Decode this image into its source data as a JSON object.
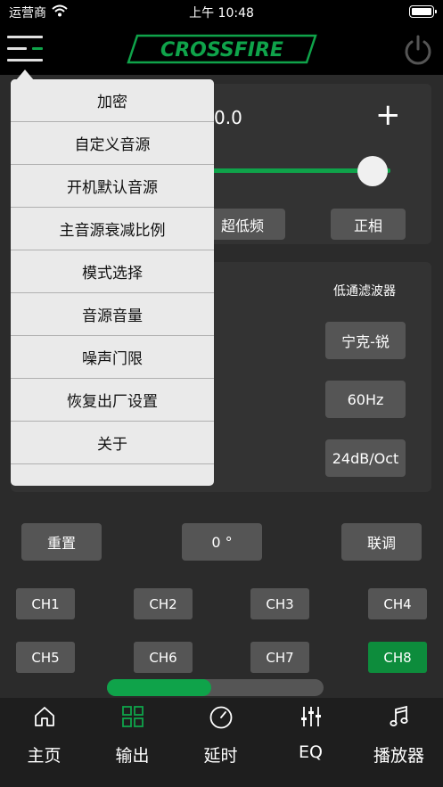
{
  "status_bar": {
    "carrier": "运营商",
    "time": "上午 10:48"
  },
  "header": {
    "logo_text": "CROSSFIRE"
  },
  "colors": {
    "accent": "#0fa34a",
    "active_channel": "#0d8c3c",
    "button": "#555555"
  },
  "main": {
    "value_text": "0.0",
    "plus_label": "+",
    "slider_level": 0.9,
    "subwoofer_button": "超低频",
    "phase_button": "正相",
    "lowpass_label": "低通滤波器",
    "filter_type": "宁克-锐",
    "frequency": "60Hz",
    "slope": "24dB/Oct"
  },
  "controls": {
    "reset": "重置",
    "phase_value": "0 °",
    "link": "联调"
  },
  "channels": [
    "CH1",
    "CH2",
    "CH3",
    "CH4",
    "CH5",
    "CH6",
    "CH7",
    "CH8"
  ],
  "active_channel": "CH8",
  "scrollbar": {
    "position_fraction": 0.48
  },
  "menu": {
    "items": [
      "加密",
      "自定义音源",
      "开机默认音源",
      "主音源衰减比例",
      "模式选择",
      "音源音量",
      "噪声门限",
      "恢复出厂设置",
      "关于"
    ]
  },
  "tabs": [
    {
      "label": "主页",
      "icon": "home-icon"
    },
    {
      "label": "输出",
      "icon": "grid-icon"
    },
    {
      "label": "延时",
      "icon": "clock-icon"
    },
    {
      "label": "EQ",
      "icon": "equalizer-icon"
    },
    {
      "label": "播放器",
      "icon": "music-note-icon"
    }
  ]
}
